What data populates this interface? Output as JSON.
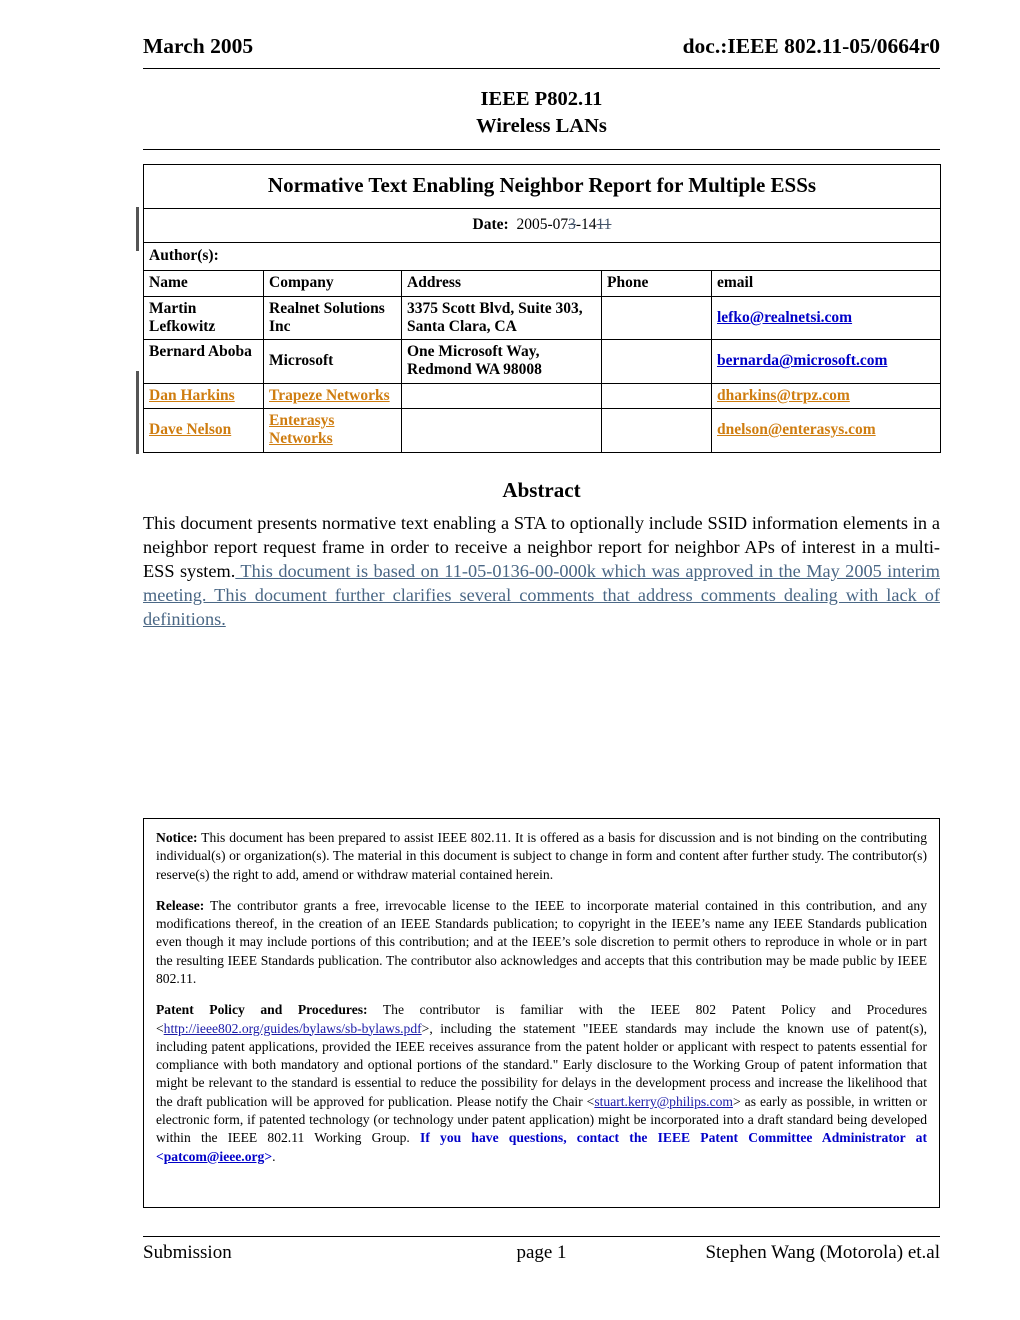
{
  "header": {
    "date_line": "March 2005",
    "doc_id": "doc.:IEEE 802.11-05/0664r0"
  },
  "standard": {
    "line1": "IEEE P802.11",
    "line2": "Wireless LANs"
  },
  "meta": {
    "title": "Normative Text Enabling Neighbor Report for Multiple ESSs",
    "date_label": "Date:",
    "date_kept_1": "2005-07",
    "date_struck_1": "3",
    "date_kept_2": "-14",
    "date_struck_2": "11",
    "authors_label": "Author(s):",
    "columns": [
      "Name",
      "Company",
      "Address",
      "Phone",
      "email"
    ],
    "rows": [
      {
        "name": "Martin Lefkowitz",
        "company": "Realnet Solutions Inc",
        "address": "3375 Scott Blvd, Suite 303, Santa Clara, CA",
        "phone": "",
        "email": "lefko@realnetsi.com",
        "inserted": false
      },
      {
        "name": "Bernard Aboba",
        "company": "Microsoft",
        "address": "One Microsoft Way, Redmond WA 98008",
        "phone": "",
        "email": "bernarda@microsoft.com",
        "inserted": false
      },
      {
        "name": "Dan Harkins",
        "company": "Trapeze Networks",
        "address": "",
        "phone": "",
        "email": "dharkins@trpz.com",
        "inserted": true
      },
      {
        "name": "Dave Nelson",
        "company": "Enterasys Networks",
        "address": "",
        "phone": "",
        "email": "dnelson@enterasys.com",
        "inserted": true
      }
    ]
  },
  "abstract": {
    "heading": "Abstract",
    "original_text": "This document presents normative text enabling a STA to optionally include SSID information elements in a neighbor report request frame in order to receive a neighbor report for neighbor APs of interest in a multi-ESS system.",
    "inserted_text": "  This document is based on 11-05-0136-00-000k which was approved in the May 2005 interim  meeting.  This document further clarifies several comments that address comments dealing with lack of definitions. "
  },
  "notice": {
    "notice_label": "Notice:",
    "notice_text": " This document has been prepared to assist IEEE 802.11. It is offered as a basis for discussion and is not binding on the contributing individual(s) or organization(s).  The material in this document is subject to change in form and content after further study. The contributor(s) reserve(s) the right to add, amend or withdraw material contained herein.",
    "release_label": "Release:",
    "release_text": " The contributor grants a free, irrevocable license to the IEEE to incorporate material contained in this contribution, and any modifications thereof, in the creation of an IEEE Standards publication; to copyright in the IEEE’s name any IEEE Standards publication even though it may include portions of this contribution; and at the IEEE’s sole discretion to permit others to reproduce in whole or in part the resulting IEEE Standards publication.  The contributor also acknowledges and accepts that this contribution may be made public by IEEE 802.11.",
    "patent_label": "Patent Policy and Procedures:",
    "patent_text_1": " The contributor is familiar with the IEEE 802 Patent Policy and Procedures <",
    "patent_link_1": "http://ieee802.org/guides/bylaws/sb-bylaws.pdf",
    "patent_text_2": ">, including the statement \"IEEE standards may include the known use of patent(s), including patent applications, provided the IEEE receives assurance from the patent holder or applicant with respect to patents essential for compliance with both mandatory and optional portions of the standard.\"  Early disclosure to the Working Group of patent information that might be relevant to the standard is essential to reduce the possibility for delays in the development process and increase the likelihood that the draft publication will be approved for publication.  Please notify the Chair <",
    "patent_link_2": "stuart.kerry@philips.com",
    "patent_text_3": "> as early as possible, in written or electronic form, if patented technology (or technology under patent application) might be incorporated into a draft standard being developed within the IEEE 802.11 Working Group. ",
    "patent_bold_1": "If you have questions, contact the IEEE Patent Committee Administrator at <",
    "patent_link_3": "patcom@ieee.org",
    "patent_bold_2": ">",
    "patent_text_4": "."
  },
  "footer": {
    "left": "Submission",
    "center": "page 1",
    "right": "Stephen Wang (Motorola) et.al"
  },
  "colors": {
    "insertion_orange": "#cf7d10",
    "insertion_blue": "#4a6785",
    "mail_link_blue": "#0000c8",
    "inline_link_blue": "#1a1aa8",
    "change_bar": "#555555"
  }
}
